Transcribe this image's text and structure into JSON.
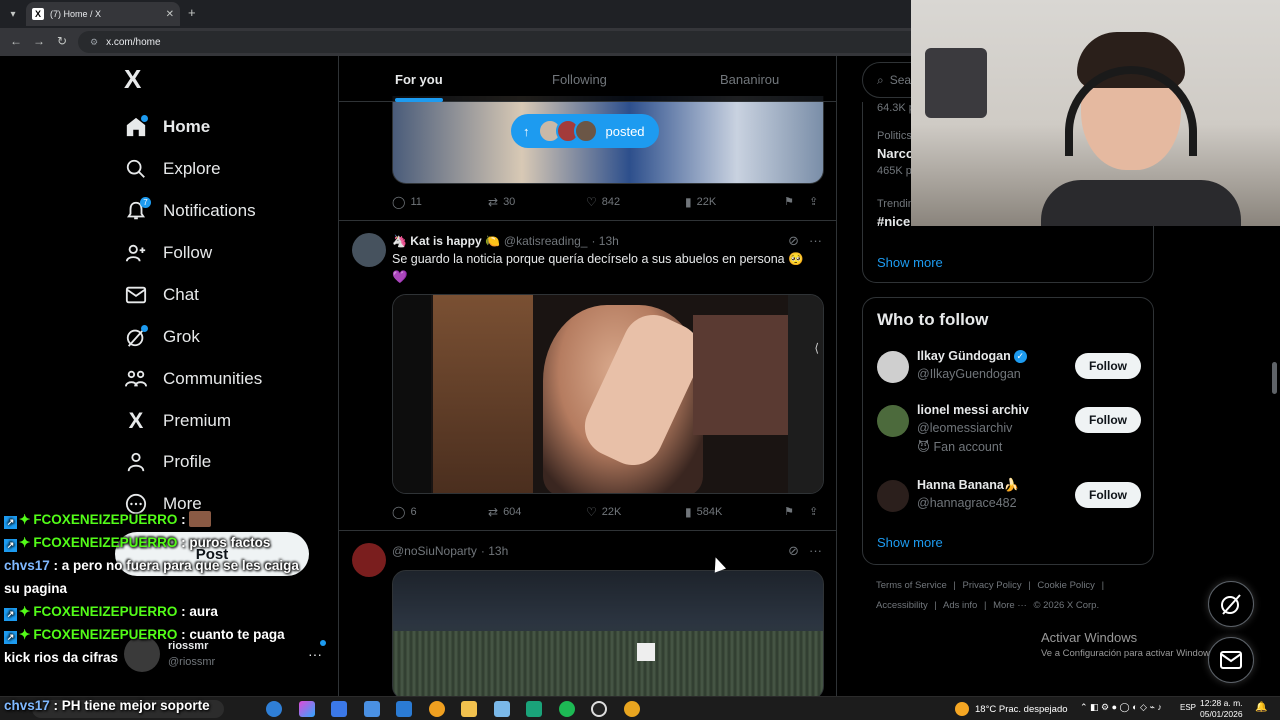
{
  "browser": {
    "tab_title": "(7) Home / X",
    "url": "x.com/home"
  },
  "sidebar": {
    "logo": "X",
    "items": [
      {
        "label": "Home",
        "icon": "home-icon"
      },
      {
        "label": "Explore",
        "icon": "search-icon"
      },
      {
        "label": "Notifications",
        "icon": "bell-icon",
        "badge": "7"
      },
      {
        "label": "Follow",
        "icon": "person-add-icon"
      },
      {
        "label": "Chat",
        "icon": "mail-icon"
      },
      {
        "label": "Grok",
        "icon": "grok-icon"
      },
      {
        "label": "Communities",
        "icon": "people-icon"
      },
      {
        "label": "Premium",
        "icon": "x-icon"
      },
      {
        "label": "Profile",
        "icon": "person-icon"
      },
      {
        "label": "More",
        "icon": "more-circle-icon"
      }
    ],
    "post_label": "Post",
    "account": {
      "name": "riossmr",
      "handle": "@riossmr"
    }
  },
  "feed": {
    "tabs": [
      "For you",
      "Following",
      "Bananirou"
    ],
    "new_posts_label": "posted",
    "tweet1_stats": {
      "replies": "11",
      "reposts": "30",
      "likes": "842",
      "views": "22K"
    },
    "tweet2": {
      "name": "🦄 Kat is happy 🍋",
      "handle": "@katisreading_",
      "time": "· 13h",
      "text": "Se guardo la noticia porque quería decírselo a sus abuelos en persona 🥺 💜",
      "stats": {
        "replies": "6",
        "reposts": "604",
        "likes": "22K",
        "views": "584K"
      }
    },
    "tweet3": {
      "handle": "@noSiuNoparty",
      "time": "· 13h"
    }
  },
  "right": {
    "search_placeholder": "Search",
    "trends": [
      {
        "meta": "64.3K posts",
        "title": ""
      },
      {
        "meta": "Politics · Trending",
        "title": "Narco",
        "count": "465K posts"
      },
      {
        "meta": "Trending",
        "title": "#nice",
        "count": ""
      }
    ],
    "show_more": "Show more",
    "who_to_follow_title": "Who to follow",
    "suggestions": [
      {
        "name": "Ilkay Gündogan",
        "handle": "@IlkayGuendogan",
        "extra": "",
        "verified": true
      },
      {
        "name": "lionel messi archiv",
        "handle": "@leomessiarchiv",
        "extra": "😈 Fan account",
        "verified": false
      },
      {
        "name": "Hanna Banana🍌",
        "handle": "@hannagrace482",
        "extra": "",
        "verified": false
      }
    ],
    "follow_label": "Follow",
    "footer": [
      "Terms of Service",
      "|",
      "Privacy Policy",
      "|",
      "Cookie Policy",
      "|",
      "Accessibility",
      "|",
      "Ads info",
      "|",
      "More ···",
      "© 2026 X Corp."
    ]
  },
  "windows": {
    "activate_title": "Activar Windows",
    "activate_sub": "Ve a Configuración para activar Windows.",
    "weather": "18°C  Prac. despejado",
    "lang": "ESP",
    "time": "12:28 a. m.",
    "date": "05/01/2026"
  },
  "chat": [
    {
      "user": "FCOXENEIZEPUERRO",
      "color": "green",
      "msg": ""
    },
    {
      "user": "FCOXENEIZEPUERRO",
      "color": "green",
      "msg": "puros factos"
    },
    {
      "user": "chvs17",
      "color": "blue",
      "msg": "a pero no fuera para que se les caiga su pagina"
    },
    {
      "user": "FCOXENEIZEPUERRO",
      "color": "green",
      "msg": "aura"
    },
    {
      "user": "FCOXENEIZEPUERRO",
      "color": "green",
      "msg": "cuanto te paga kick rios da cifras"
    },
    {
      "user": "chvs17",
      "color": "blue",
      "msg": "PH tiene mejor soporte"
    }
  ],
  "colors": {
    "accent": "#1d9bf0",
    "kick_green": "#53fc18",
    "background": "#000000"
  }
}
